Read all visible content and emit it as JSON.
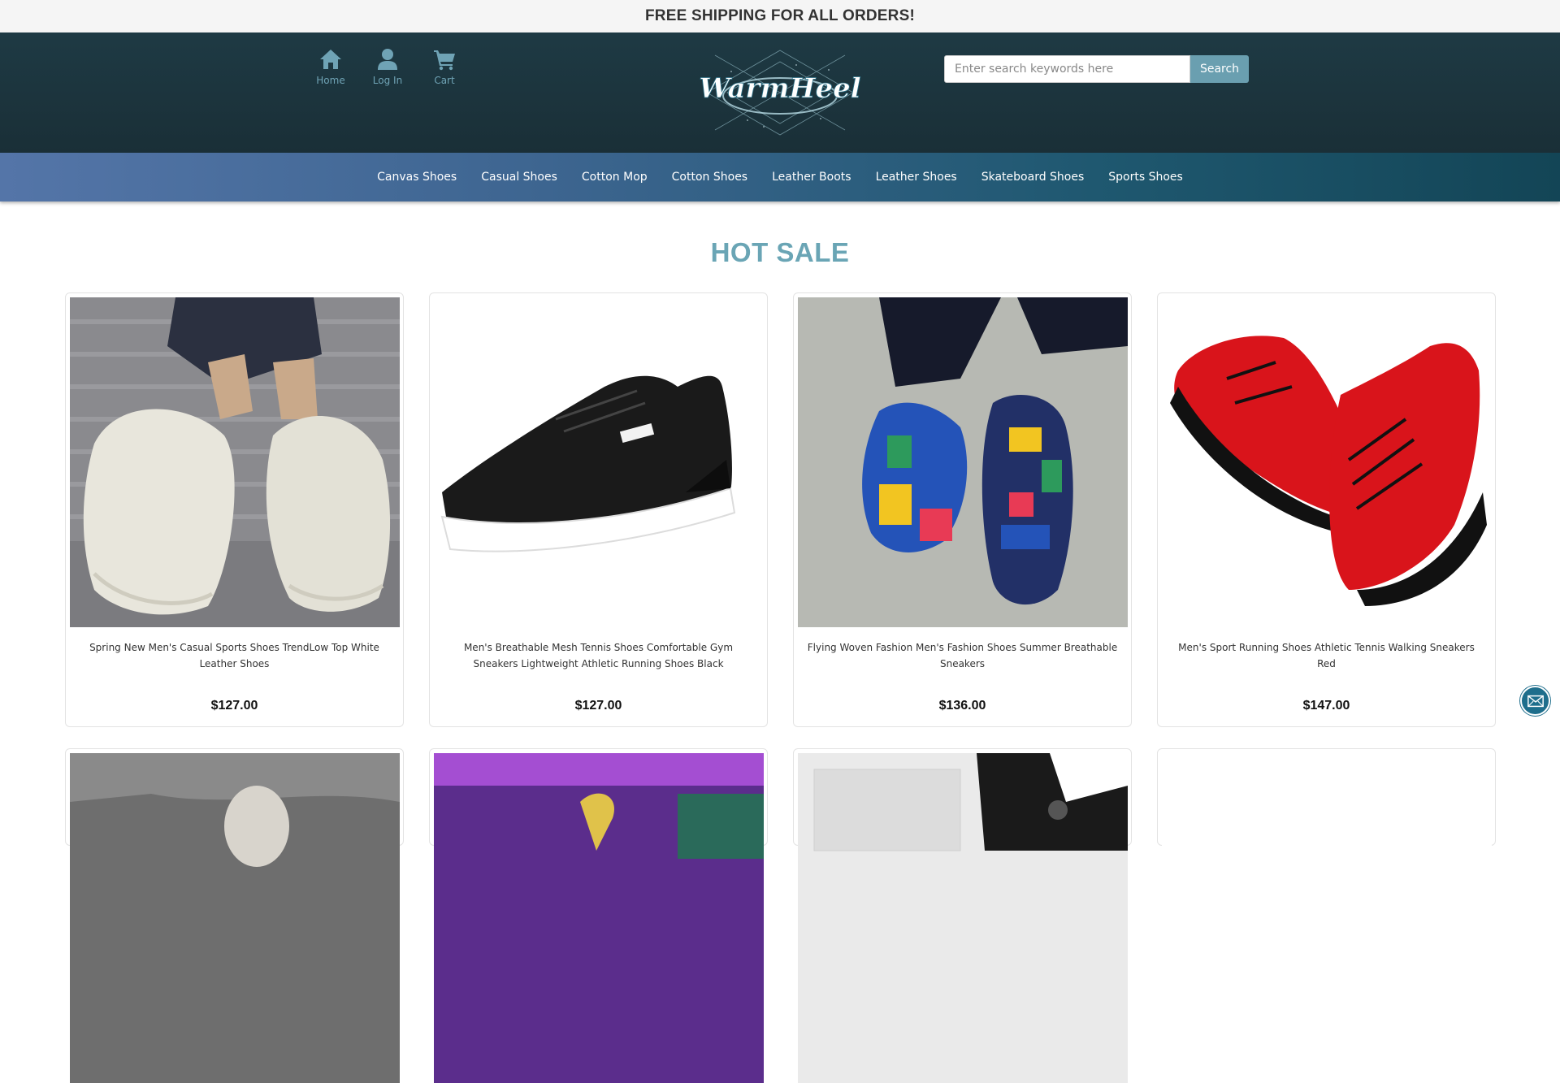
{
  "topbar": {
    "text": "FREE SHIPPING FOR ALL ORDERS!"
  },
  "header": {
    "nav": [
      {
        "label": "Home",
        "icon": "home-icon"
      },
      {
        "label": "Log In",
        "icon": "user-icon"
      },
      {
        "label": "Cart",
        "icon": "cart-icon"
      }
    ],
    "logo_text": "WarmHeel",
    "search": {
      "placeholder": "Enter search keywords here",
      "button": "Search"
    }
  },
  "categories": [
    "Canvas Shoes",
    "Casual Shoes",
    "Cotton Mop",
    "Cotton Shoes",
    "Leather Boots",
    "Leather Shoes",
    "Skateboard Shoes",
    "Sports Shoes"
  ],
  "section": {
    "title": "HOT SALE"
  },
  "products": [
    {
      "title": "Spring New Men's Casual Sports Shoes TrendLow Top White Leather Shoes",
      "price": "$127.00"
    },
    {
      "title": "Men's Breathable Mesh Tennis Shoes Comfortable Gym Sneakers Lightweight Athletic Running Shoes Black",
      "price": "$127.00"
    },
    {
      "title": "Flying Woven Fashion Men's Fashion Shoes Summer Breathable Sneakers",
      "price": "$136.00"
    },
    {
      "title": "Men's Sport Running Shoes Athletic Tennis Walking Sneakers Red",
      "price": "$147.00"
    }
  ],
  "colors": {
    "accent": "#6aa5b5",
    "header_bg": "#1e3a44",
    "search_btn": "#6a9fb0"
  }
}
